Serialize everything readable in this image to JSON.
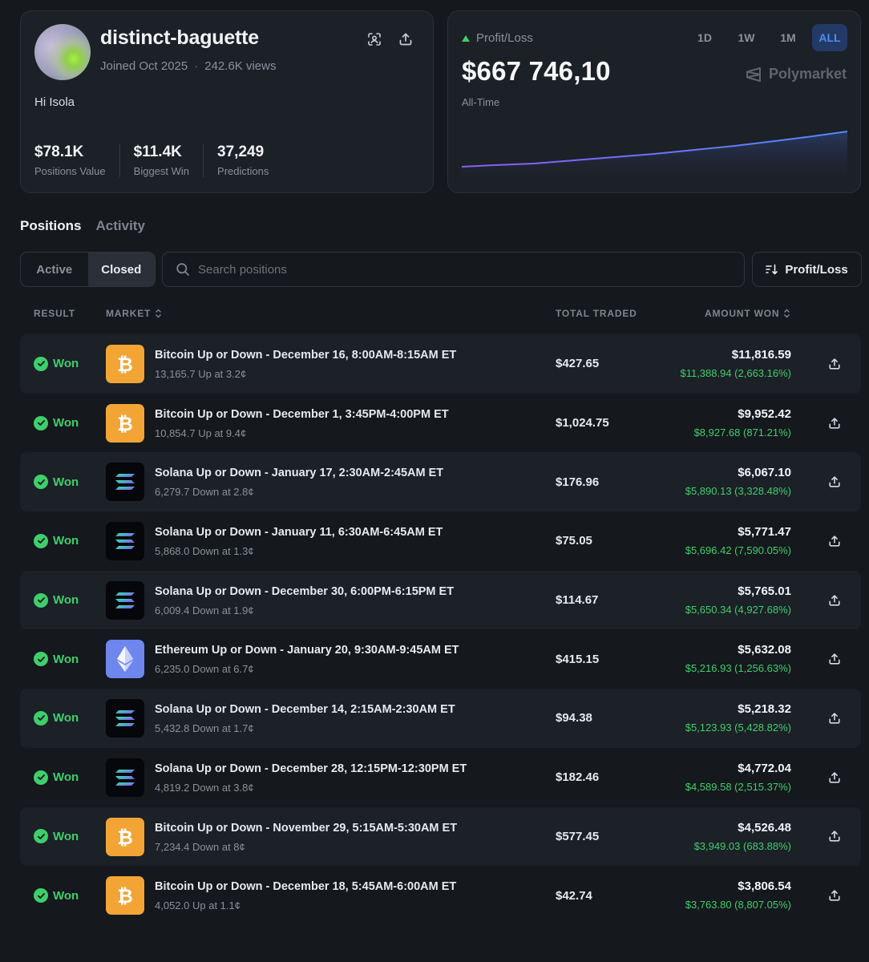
{
  "profile": {
    "username": "distinct-baguette",
    "joined": "Joined Oct 2025",
    "separator": "·",
    "views": "242.6K views",
    "bio": "Hi Isola",
    "stats": [
      {
        "value": "$78.1K",
        "label": "Positions Value"
      },
      {
        "value": "$11.4K",
        "label": "Biggest Win"
      },
      {
        "value": "37,249",
        "label": "Predictions"
      }
    ]
  },
  "pnl": {
    "label": "Profit/Loss",
    "value": "$667 746,10",
    "period": "All-Time",
    "brand": "Polymarket",
    "ranges": [
      "1D",
      "1W",
      "1M",
      "ALL"
    ],
    "active_range": "ALL",
    "line_colors": [
      "#8a5cf6",
      "#4c8df6"
    ]
  },
  "tabs": [
    "Positions",
    "Activity"
  ],
  "filters": {
    "segments": [
      "Active",
      "Closed"
    ],
    "active_segment": "Closed",
    "search_placeholder": "Search positions",
    "sort_label": "Profit/Loss"
  },
  "columns": {
    "result": "RESULT",
    "market": "MARKET",
    "total_traded": "TOTAL TRADED",
    "amount_won": "AMOUNT WON"
  },
  "rows": [
    {
      "result": "Won",
      "coin": "btc",
      "title": "Bitcoin Up or Down - December 16, 8:00AM-8:15AM ET",
      "sub": "13,165.7 Up at 3.2¢",
      "traded": "$427.65",
      "won": "$11,816.59",
      "gain": "$11,388.94 (2,663.16%)"
    },
    {
      "result": "Won",
      "coin": "btc",
      "title": "Bitcoin Up or Down - December 1, 3:45PM-4:00PM ET",
      "sub": "10,854.7 Up at 9.4¢",
      "traded": "$1,024.75",
      "won": "$9,952.42",
      "gain": "$8,927.68 (871.21%)"
    },
    {
      "result": "Won",
      "coin": "sol",
      "title": "Solana Up or Down - January 17, 2:30AM-2:45AM ET",
      "sub": "6,279.7 Down at 2.8¢",
      "traded": "$176.96",
      "won": "$6,067.10",
      "gain": "$5,890.13 (3,328.48%)"
    },
    {
      "result": "Won",
      "coin": "sol",
      "title": "Solana Up or Down - January 11, 6:30AM-6:45AM ET",
      "sub": "5,868.0 Down at 1.3¢",
      "traded": "$75.05",
      "won": "$5,771.47",
      "gain": "$5,696.42 (7,590.05%)"
    },
    {
      "result": "Won",
      "coin": "sol",
      "title": "Solana Up or Down - December 30, 6:00PM-6:15PM ET",
      "sub": "6,009.4 Down at 1.9¢",
      "traded": "$114.67",
      "won": "$5,765.01",
      "gain": "$5,650.34 (4,927.68%)"
    },
    {
      "result": "Won",
      "coin": "eth",
      "title": "Ethereum Up or Down - January 20, 9:30AM-9:45AM ET",
      "sub": "6,235.0 Down at 6.7¢",
      "traded": "$415.15",
      "won": "$5,632.08",
      "gain": "$5,216.93 (1,256.63%)"
    },
    {
      "result": "Won",
      "coin": "sol",
      "title": "Solana Up or Down - December 14, 2:15AM-2:30AM ET",
      "sub": "5,432.8 Down at 1.7¢",
      "traded": "$94.38",
      "won": "$5,218.32",
      "gain": "$5,123.93 (5,428.82%)"
    },
    {
      "result": "Won",
      "coin": "sol",
      "title": "Solana Up or Down - December 28, 12:15PM-12:30PM ET",
      "sub": "4,819.2 Down at 3.8¢",
      "traded": "$182.46",
      "won": "$4,772.04",
      "gain": "$4,589.58 (2,515.37%)"
    },
    {
      "result": "Won",
      "coin": "btc",
      "title": "Bitcoin Up or Down - November 29, 5:15AM-5:30AM ET",
      "sub": "7,234.4 Down at 8¢",
      "traded": "$577.45",
      "won": "$4,526.48",
      "gain": "$3,949.03 (683.88%)"
    },
    {
      "result": "Won",
      "coin": "btc",
      "title": "Bitcoin Up or Down - December 18, 5:45AM-6:00AM ET",
      "sub": "4,052.0 Up at 1.1¢",
      "traded": "$42.74",
      "won": "$3,806.54",
      "gain": "$3,763.80 (8,807.05%)"
    }
  ]
}
